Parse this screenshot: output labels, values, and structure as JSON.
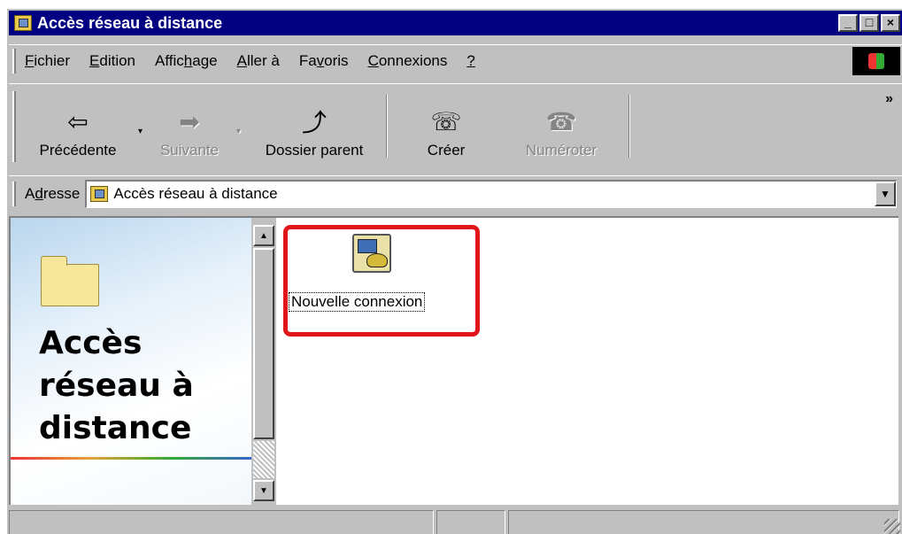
{
  "window": {
    "title": "Accès réseau à distance",
    "icon": "dialup-folder-icon",
    "controls": {
      "minimize": "_",
      "maximize": "□",
      "close": "×"
    }
  },
  "menu": {
    "items": [
      {
        "label": "Fichier",
        "accel": "F"
      },
      {
        "label": "Edition",
        "accel": "E"
      },
      {
        "label": "Affichage",
        "accel": "h"
      },
      {
        "label": "Aller à",
        "accel": "A"
      },
      {
        "label": "Favoris",
        "accel": "v"
      },
      {
        "label": "Connexions",
        "accel": "C"
      },
      {
        "label": "?",
        "accel": "?"
      }
    ]
  },
  "toolbar": {
    "back": {
      "label": "Précédente",
      "icon": "back-arrow-icon",
      "glyph": "⇦"
    },
    "forward": {
      "label": "Suivante",
      "icon": "forward-arrow-icon",
      "glyph": "➡"
    },
    "up": {
      "label": "Dossier parent",
      "icon": "folder-up-icon",
      "glyph": "⤴"
    },
    "create": {
      "label": "Créer",
      "icon": "dialup-create-icon",
      "glyph": "☏"
    },
    "dial": {
      "label": "Numéroter",
      "icon": "phone-dial-icon",
      "glyph": "☎"
    },
    "more": "»",
    "dropdown": "▾"
  },
  "address": {
    "label": "Adresse",
    "accel": "d",
    "value": "Accès réseau à distance",
    "dropdown": "▼"
  },
  "left_pane": {
    "title_line1": "Accès",
    "title_line2": "réseau à",
    "title_line3": "distance"
  },
  "scrollbar": {
    "up": "▲",
    "down": "▼"
  },
  "items": [
    {
      "label": "Nouvelle connexion",
      "icon": "new-connection-icon",
      "highlighted": true
    }
  ],
  "colors": {
    "titlebar": "#000080",
    "highlight_box": "#e0161a",
    "chrome": "#c0c0c0"
  }
}
